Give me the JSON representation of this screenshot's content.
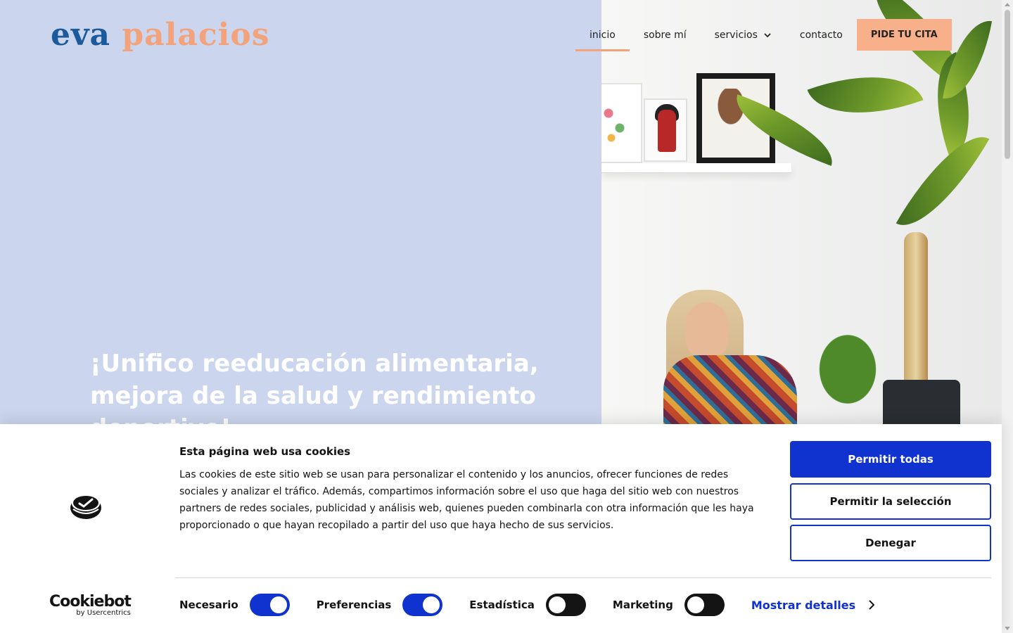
{
  "header": {
    "logo_part1": "eva ",
    "logo_part2": "palacios",
    "nav": [
      {
        "label": "inicio",
        "active": true
      },
      {
        "label": "sobre mí",
        "active": false
      },
      {
        "label": "servicios",
        "active": false,
        "has_dropdown": true
      },
      {
        "label": "contacto",
        "active": false
      }
    ],
    "cta_label": "PIDE TU CITA"
  },
  "hero": {
    "headline": "¡Unifico reeducación alimentaria, mejora de la salud y rendimiento deportivo!"
  },
  "colors": {
    "hero_bg": "#cbd6ee",
    "accent": "#f2a37c",
    "logo_blue": "#1d5a9c",
    "cookie_primary": "#1032cf"
  },
  "cookie_banner": {
    "title": "Esta página web usa cookies",
    "text": "Las cookies de este sitio web se usan para personalizar el contenido y los anuncios, ofrecer funciones de redes sociales y analizar el tráfico. Además, compartimos información sobre el uso que haga del sitio web con nuestros partners de redes sociales, publicidad y análisis web, quienes pueden combinarla con otra información que les haya proporcionado o que hayan recopilado a partir del uso que haya hecho de sus servicios.",
    "buttons": {
      "allow_all": "Permitir todas",
      "allow_selection": "Permitir la selección",
      "deny": "Denegar"
    },
    "toggles": [
      {
        "label": "Necesario",
        "on": true
      },
      {
        "label": "Preferencias",
        "on": true
      },
      {
        "label": "Estadística",
        "on": false
      },
      {
        "label": "Marketing",
        "on": false
      }
    ],
    "show_details": "Mostrar detalles",
    "brand_name": "Cookiebot",
    "brand_sub": "by Usercentrics"
  }
}
